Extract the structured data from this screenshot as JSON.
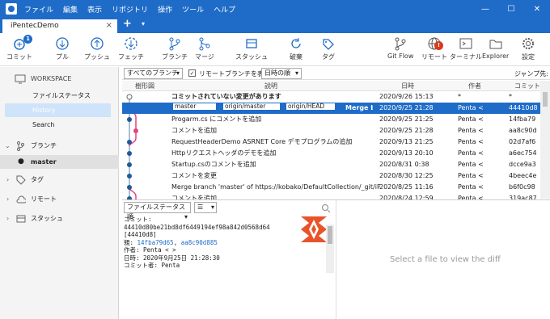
{
  "titlebar": {
    "menu": [
      "ファイル",
      "編集",
      "表示",
      "リポジトリ",
      "操作",
      "ツール",
      "ヘルプ"
    ]
  },
  "tabs": {
    "active": "iPentecDemo",
    "close": "×",
    "add": "+",
    "dropdown": "▾"
  },
  "toolbar": {
    "commit": "コミット",
    "commit_badge": "1",
    "pull": "プル",
    "push": "プッシュ",
    "fetch": "フェッチ",
    "branch": "ブランチ",
    "merge": "マージ",
    "stash": "スタッシュ",
    "discard": "破棄",
    "tag": "タグ",
    "gitflow": "Git Flow",
    "remote": "リモート",
    "remote_badge": "!",
    "terminal": "ターミナル",
    "explorer": "Explorer",
    "settings": "設定"
  },
  "sidebar": {
    "workspace": "WORKSPACE",
    "file_status": "ファイルステータス",
    "history": "History",
    "search": "Search",
    "branches": "ブランチ",
    "master": "master",
    "tags": "タグ",
    "remotes": "リモート",
    "stashes": "スタッシュ"
  },
  "filters": {
    "branches": "すべてのブランチ",
    "show_remote": "リモートブランチを表示",
    "show_remote_checked": true,
    "order": "日時の順",
    "jump": "ジャンプ先:"
  },
  "columns": {
    "graph": "樹形図",
    "desc": "説明",
    "date": "日時",
    "author": "作者",
    "commit": "コミット"
  },
  "commits": [
    {
      "desc": "コミットされていない変更があります",
      "date": "2020/9/26 15:13",
      "author": "*",
      "hash": "*",
      "bold": true
    },
    {
      "desc": "Merge bra",
      "date": "2020/9/25 21:28",
      "author": "Penta <",
      "hash": "44410d8",
      "refs": [
        "master",
        "origin/master",
        "origin/HEAD"
      ],
      "active": true
    },
    {
      "desc": "Progarm.cs にコメントを追加",
      "date": "2020/9/25 21:25",
      "author": "Penta <",
      "hash": "14fba79"
    },
    {
      "desc": "コメントを追加",
      "date": "2020/9/25 21:28",
      "author": "Penta <",
      "hash": "aa8c90d"
    },
    {
      "desc": "RequestHeaderDemo ASRNET Core デモプログラムの追加",
      "date": "2020/9/13 21:25",
      "author": "Penta <",
      "hash": "02d7af6"
    },
    {
      "desc": "Httpリクエストヘッダのデモを追加",
      "date": "2020/9/13 20:10",
      "author": "Penta <",
      "hash": "a6ec754"
    },
    {
      "desc": "Startup.csのコメントを追加",
      "date": "2020/8/31 0:38",
      "author": "Penta <",
      "hash": "dcce9a3"
    },
    {
      "desc": "コメントを変更",
      "date": "2020/8/30 12:25",
      "author": "Penta <",
      "hash": "4beec4e"
    },
    {
      "desc": "Merge branch 'master' of https://kobako/DefaultCollection/_git/iP",
      "date": "2020/8/25 11:16",
      "author": "Penta <",
      "hash": "b6f0c98"
    },
    {
      "desc": "コメントを追加",
      "date": "2020/8/24 12:59",
      "author": "Penta <",
      "hash": "319ac87"
    }
  ],
  "details": {
    "file_status_dd": "ファイルステータス順",
    "view_dd": "☰",
    "commit_label": "コミット:",
    "full_hash": "44410d80be21bd8df6449194ef98a842d0568d64",
    "short": "[44410d8]",
    "parents_label": "親:",
    "parent1": "14fba79d65",
    "parent_sep": ",",
    "parent2": "aa8c90d885",
    "author_line": "作者: Penta <            >",
    "date_line": "日時: 2020年9月25日 21:28:30",
    "committer_line": "コミット者: Penta"
  },
  "diff": {
    "placeholder": "Select a file to view the diff"
  }
}
